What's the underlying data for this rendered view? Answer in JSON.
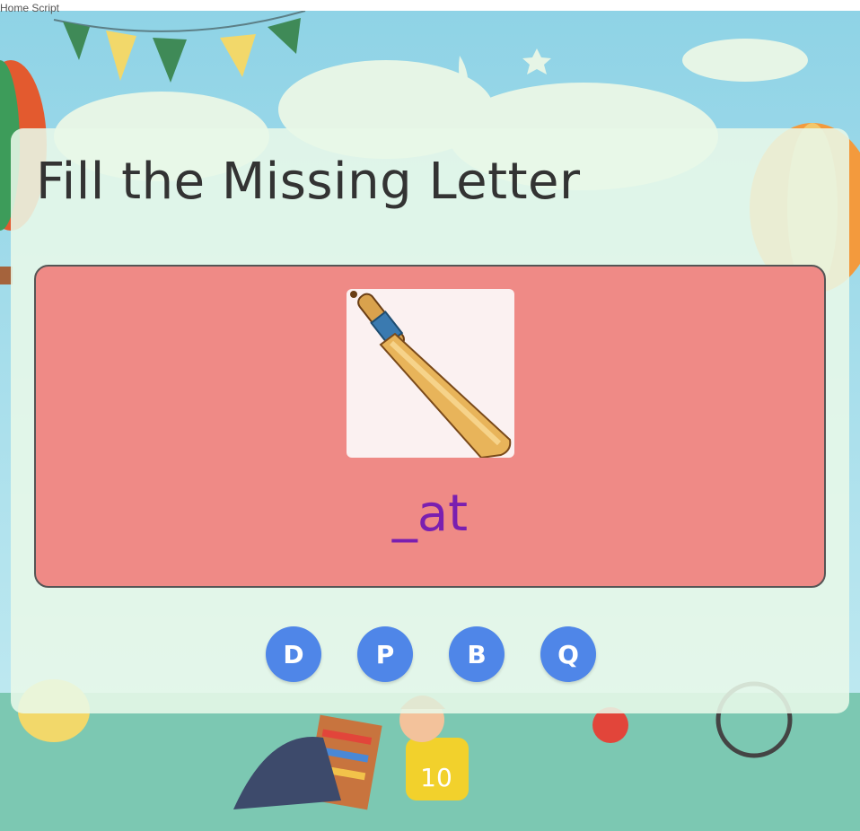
{
  "header_text": "Home Script",
  "game": {
    "title": "Fill the Missing Letter",
    "word_blank": "_",
    "word_rest": "at",
    "image_icon": "cricket-bat-icon",
    "options": [
      "D",
      "P",
      "B",
      "Q"
    ]
  },
  "colors": {
    "panel": "#ef8a86",
    "word": "#7a1fb0",
    "option": "#4f86e8",
    "card": "#e8f8e8"
  }
}
